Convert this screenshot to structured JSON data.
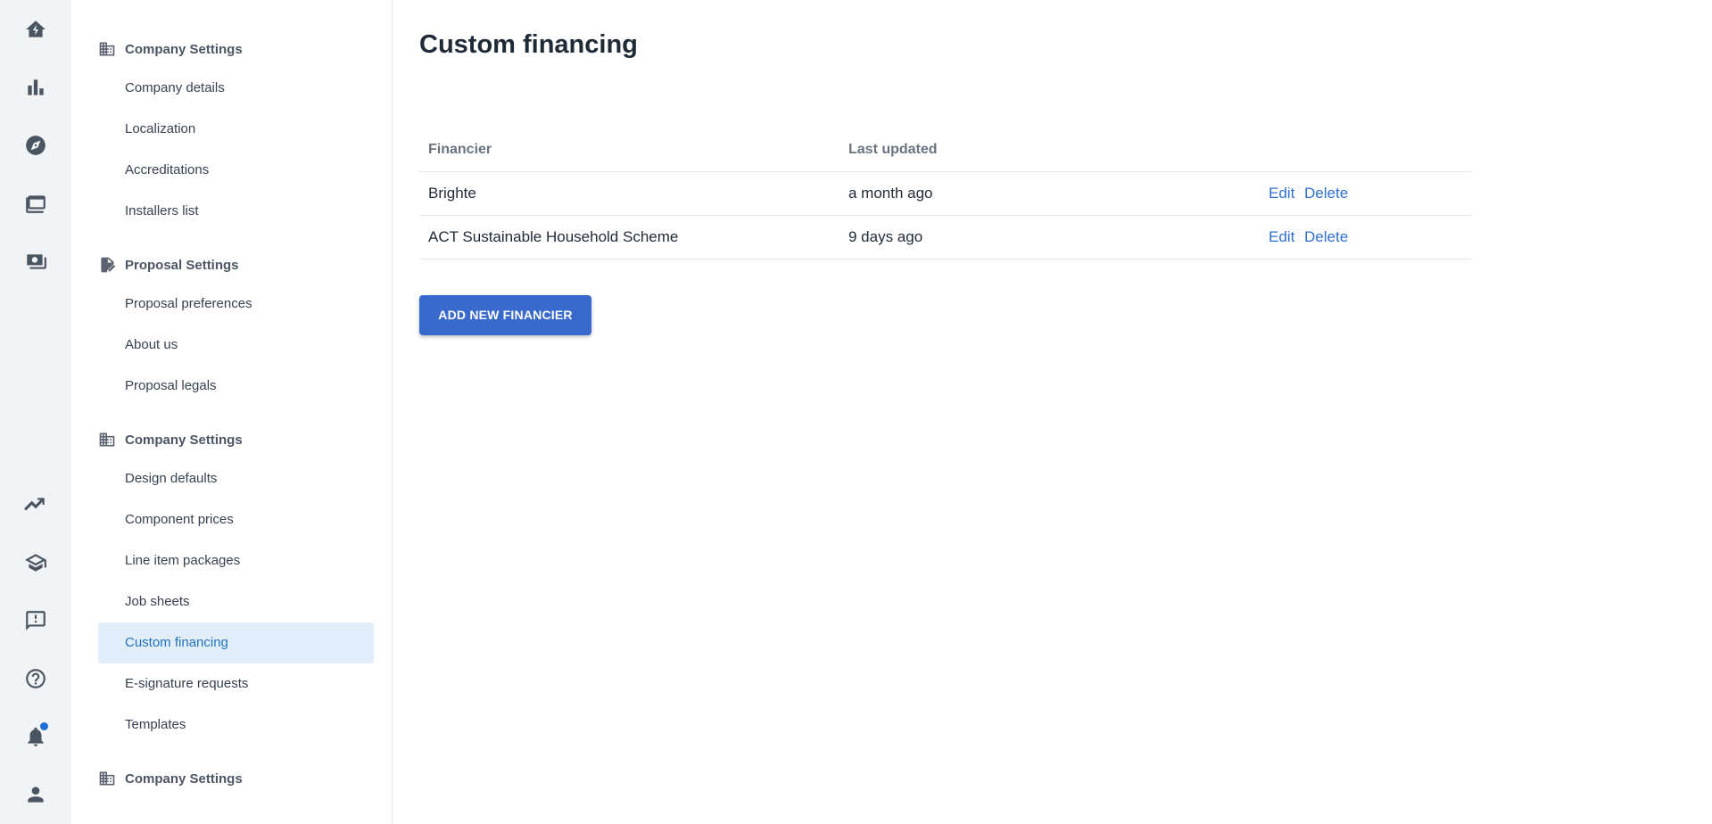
{
  "rail": {
    "items": [
      {
        "icon": "home-bolt-icon"
      },
      {
        "icon": "bar-chart-icon"
      },
      {
        "icon": "compass-icon"
      },
      {
        "icon": "folders-icon"
      },
      {
        "icon": "cash-icon"
      },
      {
        "icon": "trending-icon"
      },
      {
        "icon": "school-icon"
      },
      {
        "icon": "feedback-icon"
      },
      {
        "icon": "help-icon"
      },
      {
        "icon": "bell-icon",
        "badge": true
      },
      {
        "icon": "user-icon"
      }
    ],
    "badge_color": "#1e6fd9"
  },
  "sidebar": {
    "sections": [
      {
        "title": "Company Settings",
        "icon": "building-icon",
        "items": [
          "Company details",
          "Localization",
          "Accreditations",
          "Installers list"
        ]
      },
      {
        "title": "Proposal Settings",
        "icon": "document-edit-icon",
        "items": [
          "Proposal preferences",
          "About us",
          "Proposal legals"
        ]
      },
      {
        "title": "Company Settings",
        "icon": "building-icon",
        "items": [
          "Design defaults",
          "Component prices",
          "Line item packages",
          "Job sheets",
          "Custom financing",
          "E-signature requests",
          "Templates"
        ]
      },
      {
        "title": "Company Settings",
        "icon": "building-icon",
        "items": []
      }
    ],
    "active_item": "Custom financing",
    "active_bg": "#e2effb",
    "active_color": "#2271c3"
  },
  "main": {
    "title": "Custom financing",
    "table": {
      "headers": [
        "Financier",
        "Last updated"
      ],
      "rows": [
        {
          "financier": "Brighte",
          "updated": "a month ago",
          "edit": "Edit",
          "delete": "Delete"
        },
        {
          "financier": "ACT Sustainable Household Scheme",
          "updated": "9 days ago",
          "edit": "Edit",
          "delete": "Delete"
        }
      ]
    },
    "add_button": "ADD NEW FINANCIER",
    "accent": "#3869cc"
  }
}
